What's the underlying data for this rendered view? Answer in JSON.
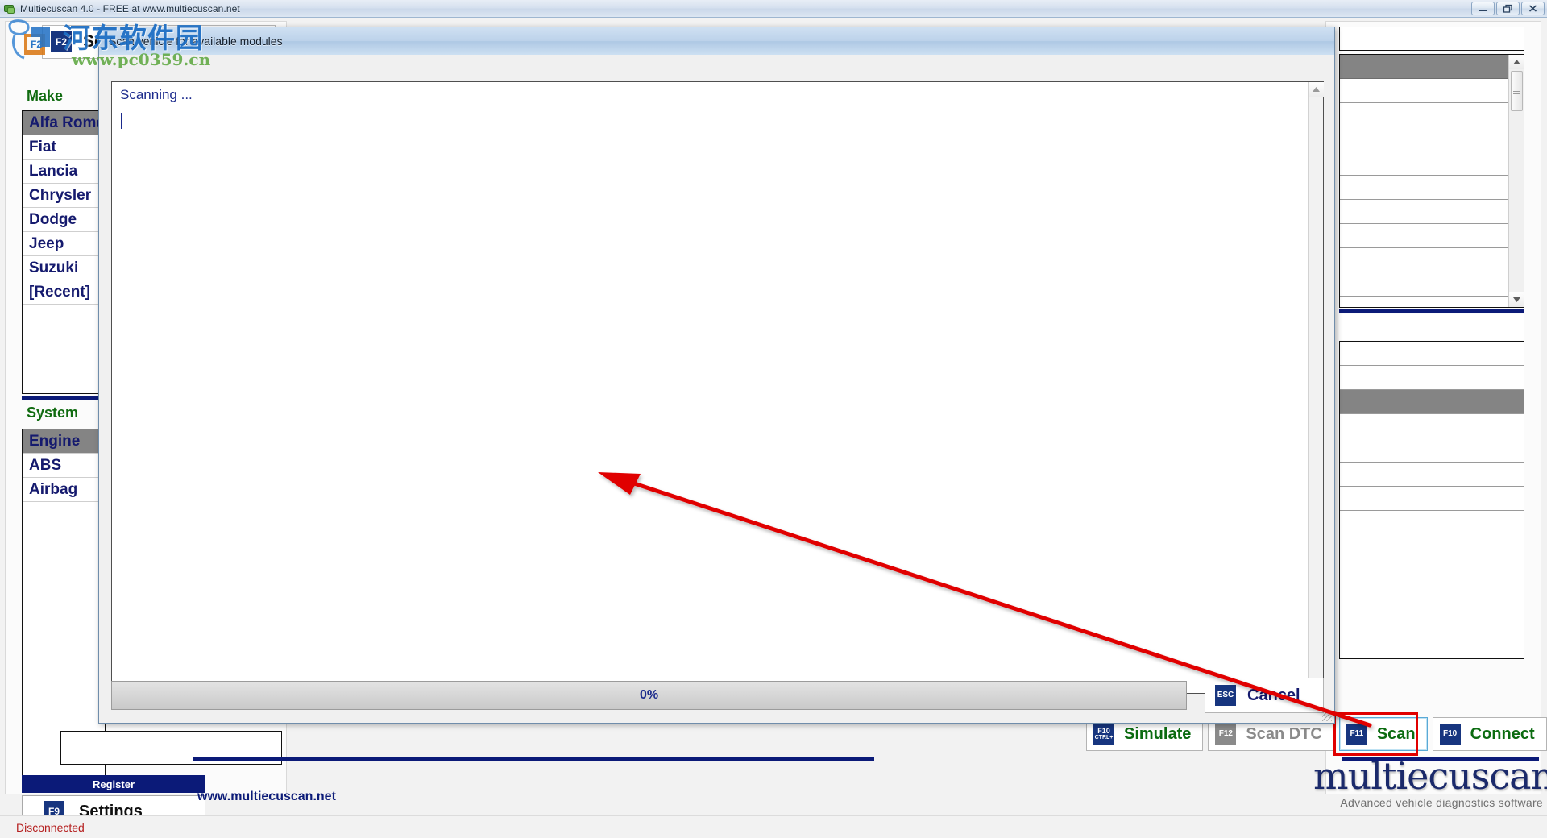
{
  "window": {
    "title": "Multiecuscan 4.0 - FREE at www.multiecuscan.net",
    "icon": "app-icon",
    "controls": {
      "minimize": "minimize",
      "restore": "restore",
      "close": "close"
    }
  },
  "watermark": {
    "text_cn": "河东软件园",
    "url": "www.pc0359.cn"
  },
  "left_panel": {
    "select_button": {
      "fkey": "F2",
      "label": "Select"
    },
    "make": {
      "header": "Make",
      "items": [
        {
          "label": "Alfa Romeo",
          "selected": true
        },
        {
          "label": "Fiat",
          "selected": false
        },
        {
          "label": "Lancia",
          "selected": false
        },
        {
          "label": "Chrysler",
          "selected": false
        },
        {
          "label": "Dodge",
          "selected": false
        },
        {
          "label": "Jeep",
          "selected": false
        },
        {
          "label": "Suzuki",
          "selected": false
        },
        {
          "label": "[Recent]",
          "selected": false
        }
      ]
    },
    "system": {
      "header": "System",
      "items": [
        {
          "label": "Engine",
          "selected": true
        },
        {
          "label": "ABS",
          "selected": false
        },
        {
          "label": "Airbag",
          "selected": false
        }
      ]
    },
    "register_label": "Register",
    "settings_button": {
      "fkey": "F9",
      "label": "Settings"
    }
  },
  "dialog": {
    "title": "Scan vehicle for available modules",
    "log_text": "Scanning ...",
    "progress": {
      "percent": 0,
      "label": "0%"
    },
    "cancel_button": {
      "fkey": "ESC",
      "label": "Cancel"
    }
  },
  "actions": [
    {
      "name": "simulate",
      "fkey_top": "F10",
      "fkey_bottom": "CTRL+",
      "label": "Simulate",
      "state": "enabled",
      "focused": false
    },
    {
      "name": "scan-dtc",
      "fkey_top": "F12",
      "fkey_bottom": "",
      "label": "Scan DTC",
      "state": "disabled",
      "focused": false
    },
    {
      "name": "scan",
      "fkey_top": "F11",
      "fkey_bottom": "",
      "label": "Scan",
      "state": "enabled",
      "focused": true
    },
    {
      "name": "connect",
      "fkey_top": "F10",
      "fkey_bottom": "",
      "label": "Connect",
      "state": "enabled",
      "focused": false
    }
  ],
  "brand": {
    "url": "www.multiecuscan.net",
    "logo_word": "multiecuscan",
    "logo_tagline": "Advanced vehicle diagnostics software"
  },
  "status": {
    "text": "Disconnected"
  },
  "colors": {
    "brand_blue": "#0b1a78",
    "green_label": "#0b6b10",
    "list_text": "#151a6e",
    "selected_row": "#848484",
    "status_red": "#b52020",
    "annotation_red": "#e00000"
  }
}
